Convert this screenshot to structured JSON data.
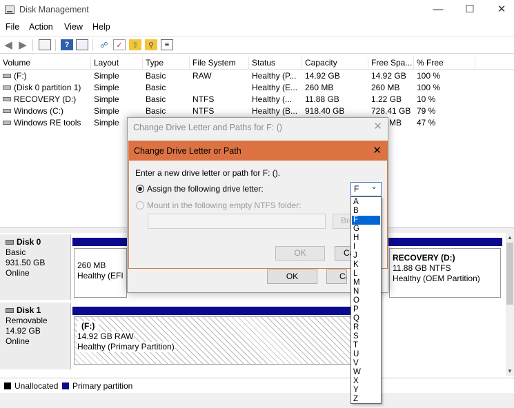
{
  "window": {
    "title": "Disk Management"
  },
  "menu": [
    "File",
    "Action",
    "View",
    "Help"
  ],
  "toolbar": {
    "icons": [
      "back-arrow-icon",
      "forward-arrow-icon",
      "console-tree-icon",
      "help-icon",
      "list-view-icon",
      "connect-icon",
      "check-icon",
      "up-folder-icon",
      "search-folder-icon",
      "properties-icon"
    ]
  },
  "volume_table": {
    "headers": [
      "Volume",
      "Layout",
      "Type",
      "File System",
      "Status",
      "Capacity",
      "Free Spa...",
      "% Free"
    ],
    "rows": [
      [
        "(F:)",
        "Simple",
        "Basic",
        "RAW",
        "Healthy (P...",
        "14.92 GB",
        "14.92 GB",
        "100 %"
      ],
      [
        "(Disk 0 partition 1)",
        "Simple",
        "Basic",
        "",
        "Healthy (E...",
        "260 MB",
        "260 MB",
        "100 %"
      ],
      [
        "RECOVERY (D:)",
        "Simple",
        "Basic",
        "NTFS",
        "Healthy (...",
        "11.88 GB",
        "1.22 GB",
        "10 %"
      ],
      [
        "Windows (C:)",
        "Simple",
        "Basic",
        "NTFS",
        "Healthy (B...",
        "918.40 GB",
        "728.41 GB",
        "79 %"
      ],
      [
        "Windows RE tools",
        "Simple",
        "",
        "",
        "",
        "",
        "MB",
        "47 %"
      ]
    ]
  },
  "disks": [
    {
      "name": "Disk 0",
      "type": "Basic",
      "size": "931.50 GB",
      "status": "Online",
      "partitions": [
        {
          "size": "260 MB",
          "status": "Healthy (EFI S"
        },
        {
          "name": "RECOVERY  (D:)",
          "size": "11.88 GB NTFS",
          "status": "Healthy (OEM Partition)"
        }
      ]
    },
    {
      "name": "Disk 1",
      "type": "Removable",
      "size": "14.92 GB",
      "status": "Online",
      "partitions": [
        {
          "name": "(F:)",
          "size": "14.92 GB RAW",
          "status": "Healthy (Primary Partition)"
        }
      ]
    }
  ],
  "legend": [
    {
      "label": "Unallocated",
      "color": "#000000"
    },
    {
      "label": "Primary partition",
      "color": "#0a0a8f"
    }
  ],
  "back_dialog": {
    "title": "Change Drive Letter and Paths for F: ()",
    "ok": "OK",
    "cancel": "Ca"
  },
  "front_dialog": {
    "title": "Change Drive Letter or Path",
    "prompt": "Enter a new drive letter or path for F: ().",
    "assign_label": "Assign the following drive letter:",
    "mount_label": "Mount in the following empty NTFS folder:",
    "browse": "Bro",
    "ok": "OK",
    "cancel": "Ca",
    "selected_letter": "F",
    "letters": [
      "A",
      "B",
      "F",
      "G",
      "H",
      "I",
      "J",
      "K",
      "L",
      "M",
      "N",
      "O",
      "P",
      "Q",
      "R",
      "S",
      "T",
      "U",
      "V",
      "W",
      "X",
      "Y",
      "Z"
    ]
  },
  "colors": {
    "accent": "#dd7242",
    "primary_partition": "#0a0a8f",
    "selection": "#0066d6"
  }
}
